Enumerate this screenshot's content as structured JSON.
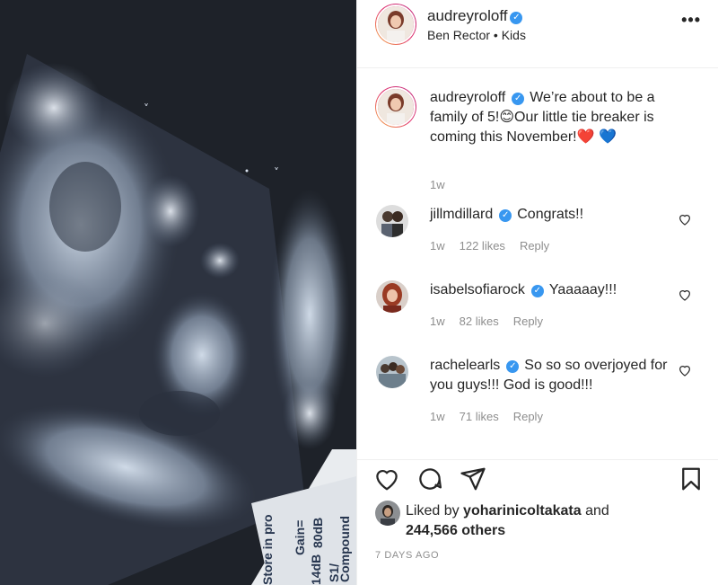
{
  "post": {
    "author": "audreyroloff",
    "subtitle": "Ben Rector • Kids",
    "more_icon": "more-horizontal-icon",
    "more_label": "•••"
  },
  "caption": {
    "author": "audreyroloff",
    "text": "We’re about to be a family of 5!😊Our little tie breaker is coming this November!❤️ 💙",
    "time": "1w"
  },
  "comments": [
    {
      "author": "jillmdillard",
      "text": "Congrats!!",
      "time": "1w",
      "likes": "122 likes",
      "reply": "Reply"
    },
    {
      "author": "isabelsofiarock",
      "text": "Yaaaaay!!!",
      "time": "1w",
      "likes": "82 likes",
      "reply": "Reply"
    },
    {
      "author": "rachelearls",
      "text": "So so so overjoyed for you guys!!! God is good!!!",
      "time": "1w",
      "likes": "71 likes",
      "reply": "Reply"
    }
  ],
  "actions": {
    "like_icon": "heart-icon",
    "comment_icon": "comment-icon",
    "share_icon": "share-icon",
    "save_icon": "bookmark-icon"
  },
  "likes": {
    "prefix": "Liked by",
    "user": "yoharinicoltakata",
    "conjunction": "and",
    "others": "244,566 others"
  },
  "timestamp": "7 DAYS AGO",
  "media_text": {
    "compound": "Compound",
    "db1": "80dB",
    "s1": "S1/",
    "gain": "Gain=",
    "db2": "14dB",
    "store": "Store in pro"
  },
  "colors": {
    "verified": "#3897f0",
    "heart_red": "#e0245e",
    "heart_blue": "#1d7be3",
    "meta_gray": "#8e8e8e"
  }
}
